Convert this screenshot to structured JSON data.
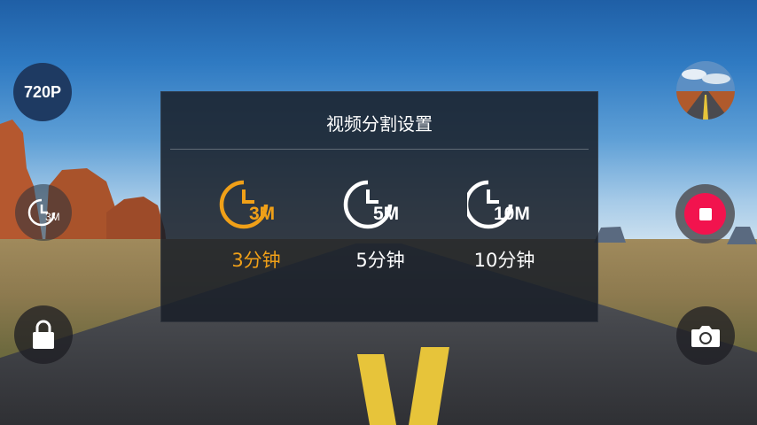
{
  "resolution_badge": "720P",
  "loop_indicator": {
    "icon": "clock-icon",
    "label": "3M"
  },
  "dialog": {
    "title": "视频分割设置",
    "options": [
      {
        "icon_label": "3M",
        "label": "3分钟",
        "selected": true
      },
      {
        "icon_label": "5M",
        "label": "5分钟",
        "selected": false
      },
      {
        "icon_label": "10M",
        "label": "10分钟",
        "selected": false
      }
    ]
  },
  "icons": {
    "lock": "lock-icon",
    "record": "record-stop-icon",
    "camera": "camera-icon",
    "thumbnail": "gallery-thumbnail"
  },
  "colors": {
    "selected": "#f0a018",
    "record": "#f2134e",
    "badge": "#1e3a62"
  }
}
